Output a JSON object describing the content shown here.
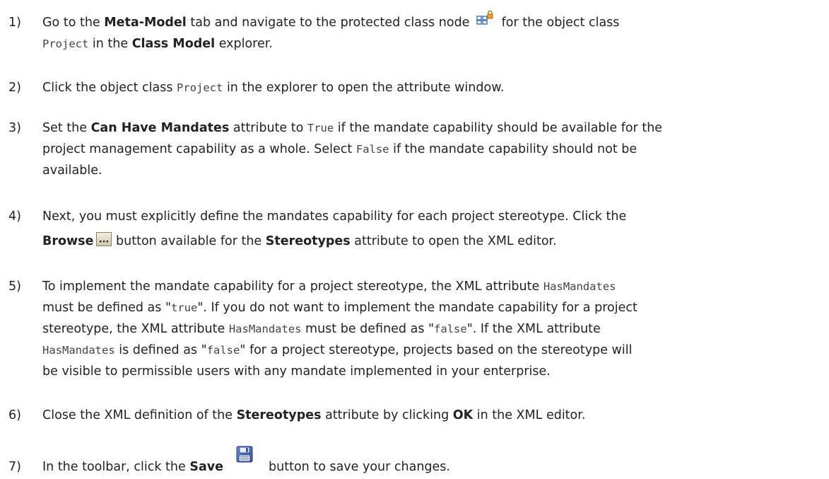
{
  "steps": [
    {
      "number": "1)",
      "t1": "Go to the ",
      "b1": "Meta-Model",
      "t2": " tab and navigate to the protected class node ",
      "icon": "protected-class-node-icon",
      "t3": " for the object class",
      "code1": "Project",
      "t4": " in the ",
      "b2": "Class Model",
      "t5": " explorer."
    },
    {
      "number": "2)",
      "t1": "Click the object class ",
      "code1": "Project",
      "t2": " in the explorer to open the attribute window."
    },
    {
      "number": "3)",
      "t1": "Set the ",
      "b1": "Can Have Mandates",
      "t2": " attribute to ",
      "code1": "True",
      "t3": " if the mandate capability should be available for the",
      "t4": "project management capability as a whole. Select ",
      "code2": "False",
      "t5": " if the mandate capability should not be",
      "t6": "available."
    },
    {
      "number": "4)",
      "t1": "Next, you must explicitly define the mandates capability for each project stereotype. Click the",
      "b1": "Browse",
      "icon": "browse-ellipsis-icon",
      "t2": " button available for the ",
      "b2": "Stereotypes",
      "t3": " attribute to open the XML editor."
    },
    {
      "number": "5)",
      "l1a": "To implement the mandate capability for a project stereotype, the XML attribute ",
      "l1code": "HasMandates",
      "l2a": "must be defined as \"",
      "l2code": "true",
      "l2b": "\". If you do not want to implement the mandate capability for a project",
      "l3a": "stereotype, the XML attribute ",
      "l3code": "HasMandates",
      "l3b": " must be defined as \"",
      "l3code2": "false",
      "l3c": "\". If the XML attribute",
      "l4code": "HasMandates",
      "l4a": " is defined as \"",
      "l4code2": "false",
      "l4b": "\" for a project stereotype, projects based on the stereotype will",
      "l5": "be visible to permissible users with any mandate implemented in your enterprise."
    },
    {
      "number": "6)",
      "t1": "Close the XML definition of the ",
      "b1": "Stereotypes",
      "t2": " attribute by clicking ",
      "b2": "OK",
      "t3": " in the XML editor."
    },
    {
      "number": "7)",
      "t1": "In the toolbar, click the ",
      "b1": "Save",
      "icon": "save-floppy-icon",
      "t2": "button to save your changes."
    }
  ],
  "colors": {
    "text": "#222222",
    "code": "#444444",
    "icon_accent": "#e8a317"
  }
}
